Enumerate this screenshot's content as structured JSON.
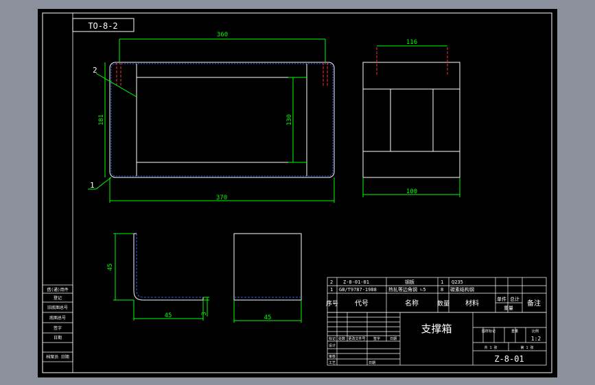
{
  "drawing": {
    "ref_code": "TO-8-2",
    "colors": {
      "background": "#000000",
      "frame": "#ffffff",
      "dimension": "#00ff00",
      "hidden": "#ff3030",
      "steel_outline": "#3a5cff"
    },
    "top_view": {
      "dim_top": "360",
      "dim_bottom": "370",
      "dim_height": "181",
      "dim_inner": "130",
      "balloon_1": "1",
      "balloon_2": "2"
    },
    "side_view": {
      "dim_top": "116",
      "dim_bottom": "100"
    },
    "angle_section": {
      "dim_height": "45",
      "dim_width": "45",
      "dim_thickness": "3"
    },
    "angle_side": {
      "dim_width": "45"
    }
  },
  "parts_list": {
    "rows": [
      {
        "no": "2",
        "code": "Z-8-01-01",
        "name": "钢板",
        "qty": "1",
        "material": "Q235"
      },
      {
        "no": "1",
        "code": "GB/T9787-1988",
        "name": "热轧等边角钢 ∟5",
        "qty": "8",
        "material": "碳素结构钢"
      }
    ],
    "header": {
      "no": "序号",
      "code": "代号",
      "name": "名称",
      "qty": "数量",
      "material": "材料",
      "unit_weight": "单件",
      "total_weight": "总计",
      "weight": "重量",
      "remark": "备注"
    }
  },
  "title_block": {
    "title": "支撑箱",
    "drawing_no": "Z-8-01",
    "scale": "1:2",
    "stage_label": "图样标记",
    "weight_label": "重量",
    "scale_label": "比例",
    "sheets": "共 1 张",
    "sheet": "第 1 张",
    "rev_labels": [
      "标记",
      "处数",
      "更改文件号",
      "签字",
      "日期"
    ],
    "sign_labels": [
      "设计",
      "审核",
      "工艺"
    ],
    "date_label": "日期"
  },
  "side_panel": {
    "rows": [
      "借(通)用件",
      "登记",
      "旧底图总号",
      "底图总号",
      "签字",
      "日期",
      "档案员 日期"
    ]
  }
}
